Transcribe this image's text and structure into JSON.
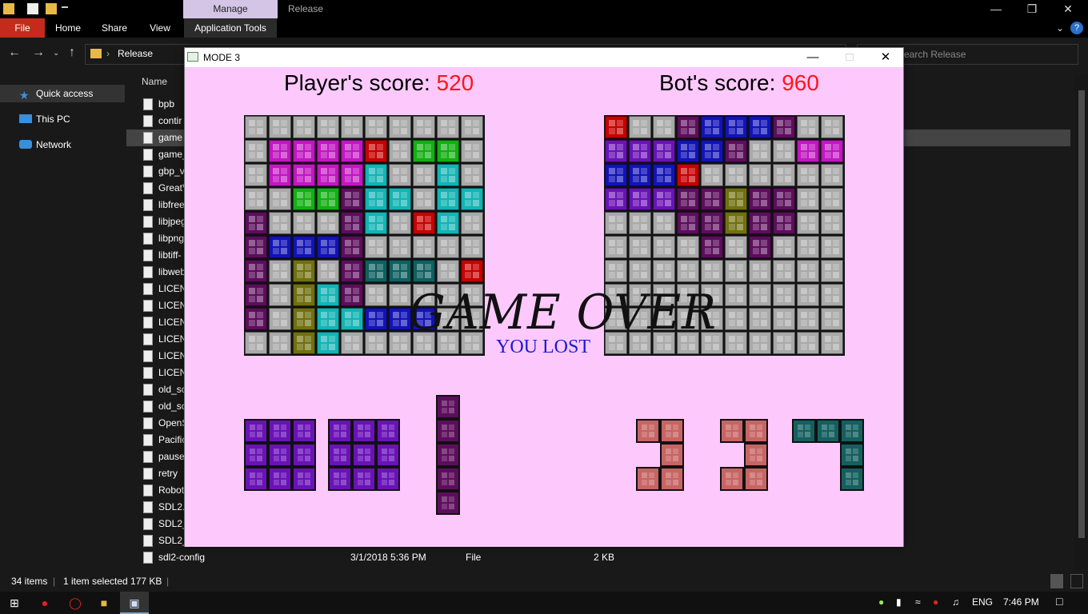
{
  "explorer": {
    "title_tab_context": "Manage",
    "title_tab_release": "Release",
    "ribbon": {
      "file": "File",
      "home": "Home",
      "share": "Share",
      "view": "View",
      "app_tools": "Application Tools"
    },
    "address": {
      "path": "Release",
      "search_placeholder": "Search Release"
    },
    "nav": [
      {
        "label": "Quick access",
        "icon": "star-icon"
      },
      {
        "label": "This PC",
        "icon": "pc-icon"
      },
      {
        "label": "Network",
        "icon": "network-icon"
      }
    ],
    "column_name": "Name",
    "files": [
      {
        "name": "bpb"
      },
      {
        "name": "contir"
      },
      {
        "name": "game",
        "selected": true
      },
      {
        "name": "game_"
      },
      {
        "name": "gbp_v"
      },
      {
        "name": "GreatV"
      },
      {
        "name": "libfree"
      },
      {
        "name": "libjpeg"
      },
      {
        "name": "libpng"
      },
      {
        "name": "libtiff-"
      },
      {
        "name": "libweb"
      },
      {
        "name": "LICEN"
      },
      {
        "name": "LICEN"
      },
      {
        "name": "LICEN"
      },
      {
        "name": "LICEN"
      },
      {
        "name": "LICEN"
      },
      {
        "name": "LICEN"
      },
      {
        "name": "old_sc"
      },
      {
        "name": "old_sc"
      },
      {
        "name": "OpenS"
      },
      {
        "name": "Pacific"
      },
      {
        "name": "pause"
      },
      {
        "name": "retry"
      },
      {
        "name": "Robot"
      },
      {
        "name": "SDL2.c"
      },
      {
        "name": "SDL2_"
      },
      {
        "name": "SDL2_"
      },
      {
        "name": "sdl2-config",
        "date": "3/1/2018 5:36 PM",
        "type": "File",
        "size": "2 KB"
      }
    ],
    "status": {
      "items": "34 items",
      "selected": "1 item selected  177 KB"
    }
  },
  "taskbar": {
    "lang": "ENG",
    "time": "7:46 PM"
  },
  "game": {
    "window_title": "MODE 3",
    "player_label": "Player's score: ",
    "player_score": "520",
    "bot_label": "Bot's score: ",
    "bot_score": "960",
    "game_over": "GAME OVER",
    "result": "YOU LOST",
    "colors": {
      "G": "#a9a9a9",
      "M": "#c316c3",
      "R": "#c80000",
      "L": "#12b012",
      "P": "#5c0e5c",
      "C": "#12b4b4",
      "B": "#1212b9",
      "O": "#707010",
      "T": "#0e6060",
      "V": "#6a12b8",
      "S": "#c86464",
      "D": "#145f5f"
    },
    "player_board": [
      "GGGGGGGGGG",
      "GMMMMRGLLG",
      "GMMMMCGGCG",
      "GGLLPCCGCC",
      "PGGGPCGRCG",
      "PBBBPGGGGG",
      "PGOGPTTTGR",
      "PGOCPGGGGG",
      "PGOCCBBBGG",
      "GGOCGGGGGG"
    ],
    "bot_board": [
      "RGGPBBBPGG",
      "VVVBBPGGMM",
      "BBBRGGGGGG",
      "VVVPPOPPGG",
      "GGGPPOPPGG",
      "GGGGPGPGGG",
      "GGGGGGGGGG",
      "GGGGGGGGGG",
      "GGGGGGGGGG",
      "GGGGGGGGGG"
    ],
    "player_next": [
      {
        "color": "V",
        "cells": [
          [
            0,
            0
          ],
          [
            1,
            0
          ],
          [
            2,
            0
          ],
          [
            0,
            1
          ],
          [
            1,
            1
          ],
          [
            2,
            1
          ],
          [
            0,
            2
          ],
          [
            1,
            2
          ],
          [
            2,
            2
          ]
        ]
      },
      {
        "color": "V",
        "cells": [
          [
            0,
            0
          ],
          [
            1,
            0
          ],
          [
            2,
            0
          ],
          [
            0,
            1
          ],
          [
            1,
            1
          ],
          [
            2,
            1
          ],
          [
            0,
            2
          ],
          [
            1,
            2
          ],
          [
            2,
            2
          ]
        ]
      },
      {
        "color": "P",
        "cells": [
          [
            0,
            0
          ],
          [
            0,
            1
          ],
          [
            0,
            2
          ],
          [
            0,
            3
          ],
          [
            0,
            4
          ]
        ]
      }
    ],
    "bot_next": [
      {
        "color": "S",
        "cells": [
          [
            0,
            0
          ],
          [
            1,
            0
          ],
          [
            1,
            1
          ],
          [
            0,
            2
          ],
          [
            1,
            2
          ]
        ]
      },
      {
        "color": "S",
        "cells": [
          [
            0,
            0
          ],
          [
            1,
            0
          ],
          [
            1,
            1
          ],
          [
            0,
            2
          ],
          [
            1,
            2
          ]
        ]
      },
      {
        "color": "D",
        "cells": [
          [
            0,
            0
          ],
          [
            1,
            0
          ],
          [
            2,
            0
          ],
          [
            2,
            1
          ],
          [
            2,
            2
          ]
        ]
      }
    ]
  }
}
